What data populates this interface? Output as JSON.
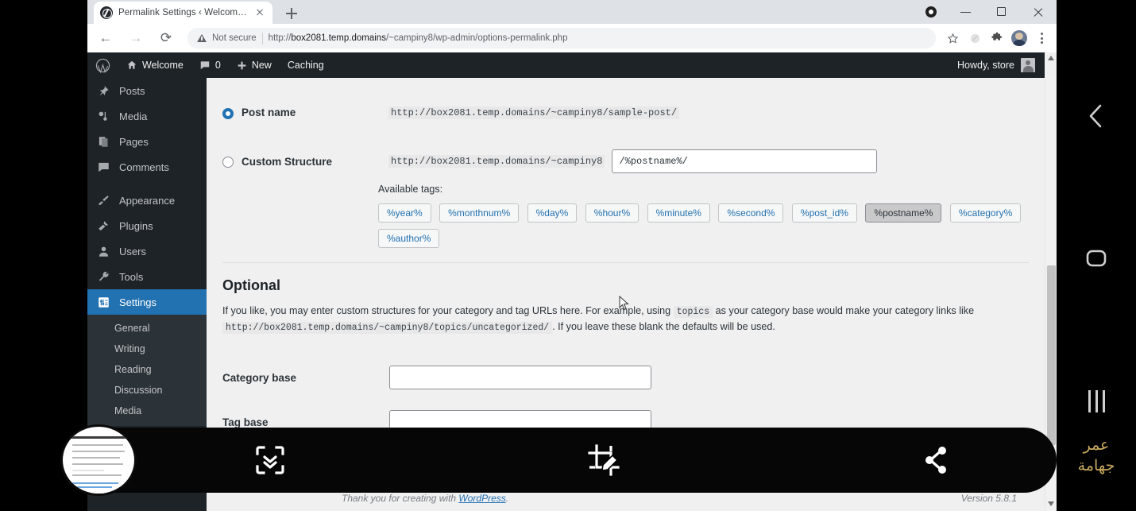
{
  "browser": {
    "tab": {
      "title": "Permalink Settings ‹ Welcome —",
      "favicon": "wordpress-favicon"
    },
    "new_tab_label": "+",
    "window_controls": {
      "record": "record-icon",
      "minimize": "minimize-icon",
      "maximize": "maximize-icon",
      "close": "close-icon"
    },
    "omnibox": {
      "security_label": "Not secure",
      "url_prefix": "http://",
      "url_host": "box2081.temp.domains",
      "url_path": "/~campiny8/wp-admin/options-permalink.php",
      "url_full": "http://box2081.temp.domains/~campiny8/wp-admin/options-permalink.php"
    },
    "toolbar_icons": [
      "bookmark-star-icon",
      "extension-icon",
      "extensions-puzzle-icon",
      "profile-avatar",
      "chrome-menu-icon"
    ]
  },
  "adminbar": {
    "logo": "wordpress-logo-icon",
    "site_name": "Welcome",
    "comments_count": "0",
    "new_label": "New",
    "caching_label": "Caching",
    "howdy": "Howdy, store"
  },
  "sidebar": {
    "items": [
      {
        "label": "Posts",
        "icon": "pin-icon"
      },
      {
        "label": "Media",
        "icon": "media-icon"
      },
      {
        "label": "Pages",
        "icon": "pages-icon"
      },
      {
        "label": "Comments",
        "icon": "comment-bubble-icon"
      },
      {
        "label": "Appearance",
        "icon": "brush-icon"
      },
      {
        "label": "Plugins",
        "icon": "plug-icon"
      },
      {
        "label": "Users",
        "icon": "user-icon"
      },
      {
        "label": "Tools",
        "icon": "wrench-icon"
      },
      {
        "label": "Settings",
        "icon": "settings-sliders-icon",
        "current": true
      }
    ],
    "submenu": [
      "General",
      "Writing",
      "Reading",
      "Discussion",
      "Media"
    ]
  },
  "permalinks": {
    "options": [
      {
        "label": "Post name",
        "example": "http://box2081.temp.domains/~campiny8/sample-post/",
        "selected": true
      },
      {
        "label": "Custom Structure",
        "prefix": "http://box2081.temp.domains/~campiny8",
        "value": "/%postname%/",
        "selected": false
      }
    ],
    "available_tags_label": "Available tags:",
    "tags": [
      {
        "label": "%year%",
        "active": false
      },
      {
        "label": "%monthnum%",
        "active": false
      },
      {
        "label": "%day%",
        "active": false
      },
      {
        "label": "%hour%",
        "active": false
      },
      {
        "label": "%minute%",
        "active": false
      },
      {
        "label": "%second%",
        "active": false
      },
      {
        "label": "%post_id%",
        "active": false
      },
      {
        "label": "%postname%",
        "active": true
      },
      {
        "label": "%category%",
        "active": false
      },
      {
        "label": "%author%",
        "active": false
      }
    ]
  },
  "optional": {
    "heading": "Optional",
    "desc_part1": "If you like, you may enter custom structures for your category and tag URLs here. For example, using",
    "desc_code1": "topics",
    "desc_part2": "as your category base would make your category links like",
    "desc_code2": "http://box2081.temp.domains/~campiny8/topics/uncategorized/",
    "desc_part3": ". If you leave these blank the defaults will be used.",
    "category_base_label": "Category base",
    "category_base_value": "",
    "tag_base_label": "Tag base",
    "tag_base_value": ""
  },
  "footer": {
    "thanks": "Thank you for creating with",
    "link": "WordPress",
    "punct": ".",
    "version": "Version 5.8.1"
  },
  "screenshot_toolbar": {
    "thumbnail": "screenshot-preview-thumbnail",
    "scroll_capture": "scroll-capture-icon",
    "crop_edit": "crop-edit-icon",
    "share": "share-icon"
  },
  "android_nav": {
    "back": "back-icon",
    "home": "home-icon",
    "recents": "recents-icon",
    "watermark_line1": "عمر",
    "watermark_line2": "جهامة",
    "watermark_color": "#c9ab5e"
  },
  "colors": {
    "wp_blue": "#2271b1",
    "admin_dark": "#1d2327",
    "page_bg": "#f0f0f1"
  }
}
